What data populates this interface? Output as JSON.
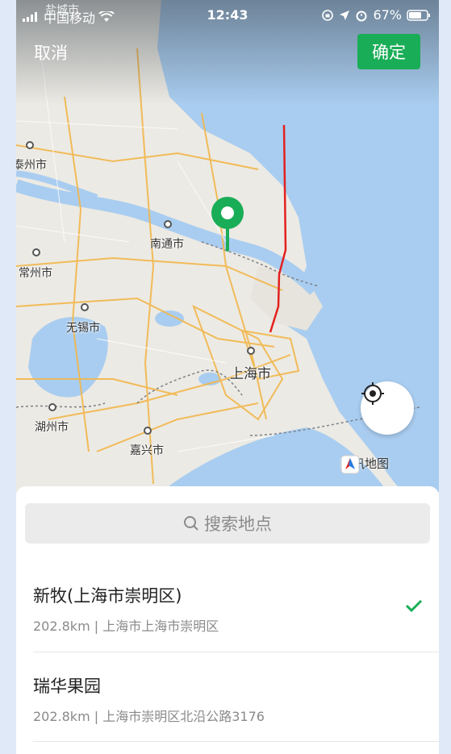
{
  "status_bar": {
    "carrier": "中国移动",
    "time": "12:43",
    "battery": "67%",
    "overlay_text": "盐城市"
  },
  "header": {
    "cancel_label": "取消",
    "confirm_label": "确定"
  },
  "map": {
    "cities": {
      "taizhou": "泰州市",
      "nantong": "南通市",
      "changzhou": "常州市",
      "wuxi": "无锡市",
      "shanghai": "上海市",
      "huzhou": "湖州市",
      "jiaxing": "嘉兴市"
    },
    "attribution": "腾讯地图",
    "marker_icon": "map-pin-icon",
    "locate_icon": "locate-target-icon"
  },
  "search": {
    "placeholder": "搜索地点",
    "icon": "search-icon"
  },
  "results": [
    {
      "name": "新牧(上海市崇明区)",
      "address": "202.8km | 上海市上海市崇明区",
      "selected": true
    },
    {
      "name": "瑞华果园",
      "address": "202.8km | 上海市崇明区北沿公路3176",
      "selected": false
    }
  ],
  "colors": {
    "accent": "#1aad57",
    "sea": "#a9cdf0",
    "land": "#eceae4",
    "route": "#e3211f"
  }
}
